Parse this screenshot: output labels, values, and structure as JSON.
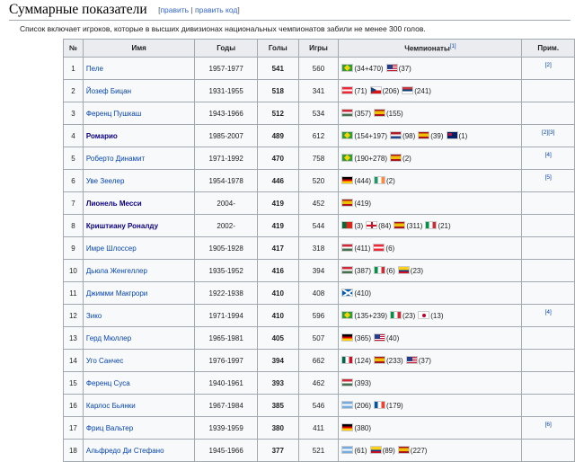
{
  "heading": {
    "title": "Суммарные показатели",
    "edit_open": "[",
    "edit": "править",
    "sep": " | ",
    "edit_code": "править код",
    "edit_close": "]"
  },
  "intro": "Список включает игроков, которые в высших дивизионах национальных чемпионатов забили не менее 300 голов.",
  "table": {
    "headers": {
      "num": "№",
      "name": "Имя",
      "years": "Годы",
      "goals": "Голы",
      "games": "Игры",
      "champs": "Чемпионаты",
      "champs_note": "[1]",
      "note": "Прим."
    },
    "rows": [
      {
        "num": "1",
        "name": "Пеле",
        "years": "1957-1977",
        "goals": "541",
        "games": "560",
        "bold": false,
        "note": "[2]",
        "champs": [
          {
            "flag": "brazil",
            "text": "(34+470)"
          },
          {
            "flag": "usa",
            "text": "(37)"
          }
        ]
      },
      {
        "num": "2",
        "name": "Йозеф Бицан",
        "years": "1931-1955",
        "goals": "518",
        "games": "341",
        "bold": false,
        "note": "",
        "champs": [
          {
            "flag": "austria",
            "text": "(71)"
          },
          {
            "flag": "czech",
            "text": "(206)"
          },
          {
            "flag": "serbia",
            "text": "(241)"
          }
        ]
      },
      {
        "num": "3",
        "name": "Ференц Пушкаш",
        "years": "1943-1966",
        "goals": "512",
        "games": "534",
        "bold": false,
        "note": "",
        "champs": [
          {
            "flag": "hungary",
            "text": "(357)"
          },
          {
            "flag": "spain",
            "text": "(155)"
          }
        ]
      },
      {
        "num": "4",
        "name": "Ромарио",
        "years": "1985-2007",
        "goals": "489",
        "games": "612",
        "bold": true,
        "note": "[2][3]",
        "champs": [
          {
            "flag": "brazil",
            "text": "(154+197)"
          },
          {
            "flag": "netherlands",
            "text": "(98)"
          },
          {
            "flag": "spain",
            "text": "(39)"
          },
          {
            "flag": "australia",
            "text": "(1)"
          }
        ]
      },
      {
        "num": "5",
        "name": "Роберто Динамит",
        "years": "1971-1992",
        "goals": "470",
        "games": "758",
        "bold": false,
        "note": "[4]",
        "champs": [
          {
            "flag": "brazil",
            "text": "(190+278)"
          },
          {
            "flag": "spain",
            "text": "(2)"
          }
        ]
      },
      {
        "num": "6",
        "name": "Уве Зеелер",
        "years": "1954-1978",
        "goals": "446",
        "games": "520",
        "bold": false,
        "note": "[5]",
        "champs": [
          {
            "flag": "germany",
            "text": "(444)"
          },
          {
            "flag": "ireland",
            "text": "(2)"
          }
        ]
      },
      {
        "num": "7",
        "name": "Лионель Месси",
        "years": "2004-",
        "goals": "419",
        "games": "452",
        "bold": true,
        "note": "",
        "champs": [
          {
            "flag": "spain",
            "text": "(419)"
          }
        ]
      },
      {
        "num": "8",
        "name": "Криштиану Роналду",
        "years": "2002-",
        "goals": "419",
        "games": "544",
        "bold": true,
        "note": "",
        "champs": [
          {
            "flag": "portugal",
            "text": "(3)"
          },
          {
            "flag": "england",
            "text": "(84)"
          },
          {
            "flag": "spain",
            "text": "(311)"
          },
          {
            "flag": "italy",
            "text": "(21)"
          }
        ]
      },
      {
        "num": "9",
        "name": "Имре Шлоссер",
        "years": "1905-1928",
        "goals": "417",
        "games": "318",
        "bold": false,
        "note": "",
        "champs": [
          {
            "flag": "hungary",
            "text": "(411)"
          },
          {
            "flag": "austria",
            "text": "(6)"
          }
        ]
      },
      {
        "num": "10",
        "name": "Дьюла Женгеллер",
        "years": "1935-1952",
        "goals": "416",
        "games": "394",
        "bold": false,
        "note": "",
        "champs": [
          {
            "flag": "hungary",
            "text": "(387)"
          },
          {
            "flag": "italy",
            "text": "(6)"
          },
          {
            "flag": "colombia",
            "text": "(23)"
          }
        ]
      },
      {
        "num": "11",
        "name": "Джимми Макгрори",
        "years": "1922-1938",
        "goals": "410",
        "games": "408",
        "bold": false,
        "note": "",
        "champs": [
          {
            "flag": "scotland",
            "text": "(410)"
          }
        ]
      },
      {
        "num": "12",
        "name": "Зико",
        "years": "1971-1994",
        "goals": "410",
        "games": "596",
        "bold": false,
        "note": "[4]",
        "champs": [
          {
            "flag": "brazil",
            "text": "(135+239)"
          },
          {
            "flag": "italy",
            "text": "(23)"
          },
          {
            "flag": "japan",
            "text": "(13)"
          }
        ]
      },
      {
        "num": "13",
        "name": "Герд Мюллер",
        "years": "1965-1981",
        "goals": "405",
        "games": "507",
        "bold": false,
        "note": "",
        "champs": [
          {
            "flag": "germany",
            "text": "(365)"
          },
          {
            "flag": "usa",
            "text": "(40)"
          }
        ]
      },
      {
        "num": "14",
        "name": "Уго Санчес",
        "years": "1976-1997",
        "goals": "394",
        "games": "662",
        "bold": false,
        "note": "",
        "champs": [
          {
            "flag": "mexico",
            "text": "(124)"
          },
          {
            "flag": "spain",
            "text": "(233)"
          },
          {
            "flag": "usa",
            "text": "(37)"
          }
        ]
      },
      {
        "num": "15",
        "name": "Ференц Суса",
        "years": "1940-1961",
        "goals": "393",
        "games": "462",
        "bold": false,
        "note": "",
        "champs": [
          {
            "flag": "hungary",
            "text": "(393)"
          }
        ]
      },
      {
        "num": "16",
        "name": "Карлос Бьянки",
        "years": "1967-1984",
        "goals": "385",
        "games": "546",
        "bold": false,
        "note": "",
        "champs": [
          {
            "flag": "argentina",
            "text": "(206)"
          },
          {
            "flag": "france",
            "text": "(179)"
          }
        ]
      },
      {
        "num": "17",
        "name": "Фриц Вальтер",
        "years": "1939-1959",
        "goals": "380",
        "games": "411",
        "bold": false,
        "note": "[6]",
        "champs": [
          {
            "flag": "germany",
            "text": "(380)"
          }
        ]
      },
      {
        "num": "18",
        "name": "Альфредо Ди Стефано",
        "years": "1945-1966",
        "goals": "377",
        "games": "521",
        "bold": false,
        "note": "",
        "champs": [
          {
            "flag": "argentina",
            "text": "(61)"
          },
          {
            "flag": "colombia",
            "text": "(89)"
          },
          {
            "flag": "spain",
            "text": "(227)"
          }
        ]
      }
    ]
  }
}
